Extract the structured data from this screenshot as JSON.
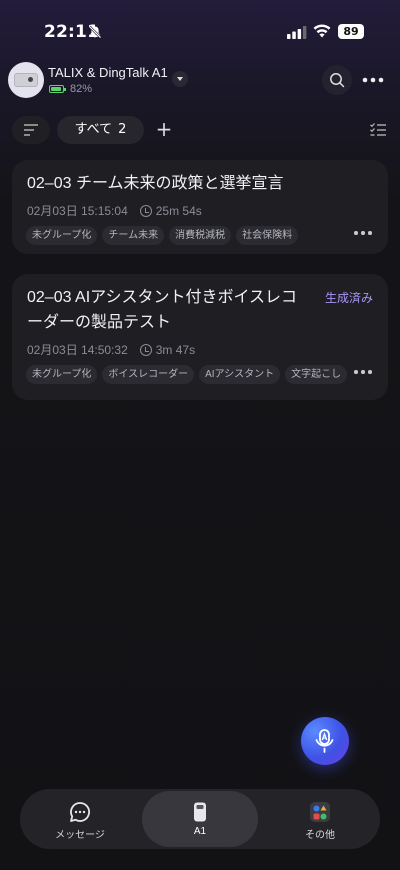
{
  "status_bar": {
    "time": "22:11",
    "battery": "89"
  },
  "device": {
    "name": "TALIX & DingTalk A1",
    "battery_level": "82%"
  },
  "filter": {
    "tab_label": "すべて",
    "tab_count": "2"
  },
  "recordings": [
    {
      "title": "02–03 チーム未来の政策と選挙宣言",
      "date": "02月03日 15:15:04",
      "duration": "25m 54s",
      "tags": [
        "未グループ化",
        "チーム未来",
        "消費税減税",
        "社会保険料"
      ],
      "status": ""
    },
    {
      "title": "02–03 AIアシスタント付きボイスレコーダーの製品テスト",
      "date": "02月03日 14:50:32",
      "duration": "3m 47s",
      "tags": [
        "未グループ化",
        "ボイスレコーダー",
        "AIアシスタント",
        "文字起こし"
      ],
      "status": "生成済み"
    }
  ],
  "bottom_nav": {
    "messages": "メッセージ",
    "a1": "A1",
    "others": "その他"
  },
  "colors": {
    "accent": "#a995f5",
    "fab": "#4a5cf0",
    "battery_green": "#5bd26a"
  }
}
